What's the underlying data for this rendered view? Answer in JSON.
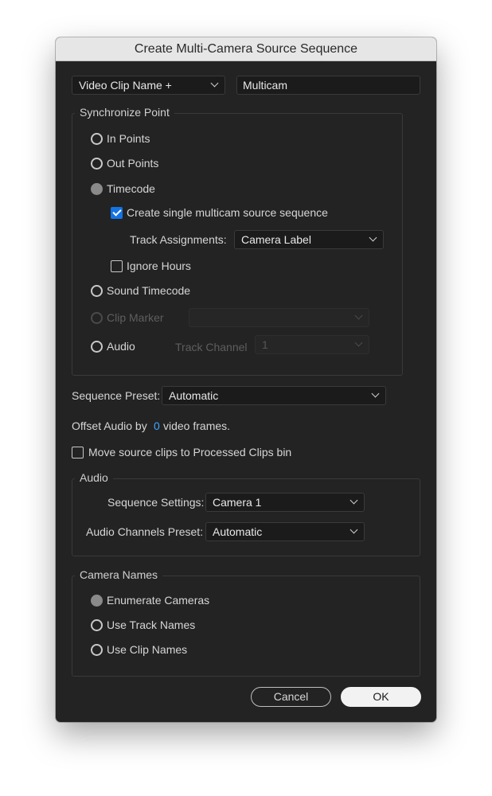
{
  "dialog": {
    "title": "Create Multi-Camera Source Sequence"
  },
  "naming": {
    "dropdown_value": "Video Clip Name +",
    "name_field": "Multicam"
  },
  "sync": {
    "title": "Synchronize Point",
    "in_points": "In Points",
    "out_points": "Out Points",
    "timecode": "Timecode",
    "create_single": "Create single multicam source sequence",
    "track_assignments_label": "Track Assignments:",
    "track_assignments_value": "Camera Label",
    "ignore_hours": "Ignore Hours",
    "sound_timecode": "Sound Timecode",
    "clip_marker": "Clip Marker",
    "clip_marker_value": "",
    "audio": "Audio",
    "track_channel_label": "Track Channel",
    "track_channel_value": "1"
  },
  "sequence_preset": {
    "label": "Sequence Preset:",
    "value": "Automatic"
  },
  "offset_audio": {
    "prefix": "Offset Audio by",
    "value": "0",
    "suffix": "video frames."
  },
  "move_clips": {
    "label": "Move source clips to Processed Clips bin"
  },
  "audio": {
    "title": "Audio",
    "sequence_settings_label": "Sequence Settings:",
    "sequence_settings_value": "Camera 1",
    "channels_preset_label": "Audio Channels Preset:",
    "channels_preset_value": "Automatic"
  },
  "camera_names": {
    "title": "Camera Names",
    "enumerate": "Enumerate Cameras",
    "track_names": "Use Track Names",
    "clip_names": "Use Clip Names"
  },
  "buttons": {
    "cancel": "Cancel",
    "ok": "OK"
  },
  "colors": {
    "accent": "#1473e6",
    "offset_value": "#3ea6ff",
    "panel": "#232323"
  },
  "state": {
    "sync_selected": "Timecode",
    "create_single_checked": true,
    "ignore_hours_checked": false,
    "move_clips_checked": false,
    "camera_names_selected": "Enumerate Cameras"
  }
}
